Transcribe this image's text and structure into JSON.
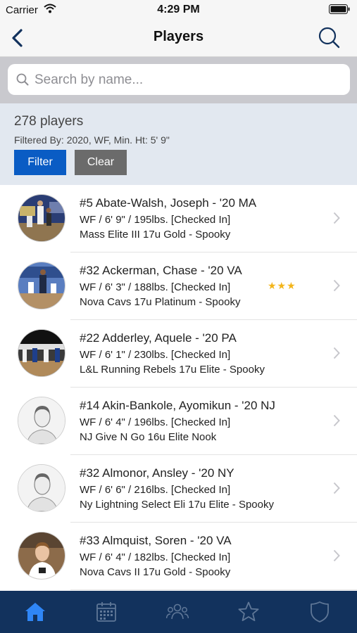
{
  "status_bar": {
    "carrier": "Carrier",
    "time": "4:29 PM"
  },
  "nav": {
    "title": "Players"
  },
  "search": {
    "placeholder": "Search by name..."
  },
  "filter": {
    "count_label": "278 players",
    "summary": "Filtered By: 2020, WF,  Min. Ht: 5' 9\"",
    "filter_label": "Filter",
    "clear_label": "Clear"
  },
  "players": [
    {
      "name": "#5 Abate-Walsh, Joseph - '20 MA",
      "details": "WF / 6' 9\" / 195lbs. [Checked In]",
      "team": "Mass Elite III 17u Gold - Spooky",
      "stars": ""
    },
    {
      "name": "#32 Ackerman, Chase - '20 VA",
      "details": "WF / 6' 3\" / 188lbs. [Checked In]",
      "team": "Nova Cavs 17u Platinum - Spooky",
      "stars": "★★★"
    },
    {
      "name": "#22 Adderley, Aquele - '20 PA",
      "details": "WF / 6' 1\" / 230lbs. [Checked In]",
      "team": "L&L Running Rebels 17u Elite - Spooky",
      "stars": ""
    },
    {
      "name": "#14 Akin-Bankole, Ayomikun - '20 NJ",
      "details": "WF / 6' 4\" / 196lbs. [Checked In]",
      "team": "NJ Give N Go 16u Elite Nook",
      "stars": ""
    },
    {
      "name": "#32 Almonor, Ansley - '20 NY",
      "details": "WF / 6' 6\" / 216lbs. [Checked In]",
      "team": "Ny Lightning Select Eli 17u Elite - Spooky",
      "stars": ""
    },
    {
      "name": "#33 Almquist, Soren - '20 VA",
      "details": "WF / 6' 4\" / 182lbs. [Checked In]",
      "team": "Nova Cavs II 17u Gold - Spooky",
      "stars": ""
    }
  ],
  "tabs": [
    {
      "icon": "home-icon",
      "active": true
    },
    {
      "icon": "calendar-icon",
      "active": false
    },
    {
      "icon": "people-icon",
      "active": false
    },
    {
      "icon": "star-icon",
      "active": false
    },
    {
      "icon": "shield-icon",
      "active": false
    }
  ],
  "colors": {
    "accent": "#0a5cc4",
    "tab_bar": "#12325d",
    "tab_active": "#2f86f6",
    "tab_inactive": "#5f7797",
    "star": "#f3b51b"
  }
}
